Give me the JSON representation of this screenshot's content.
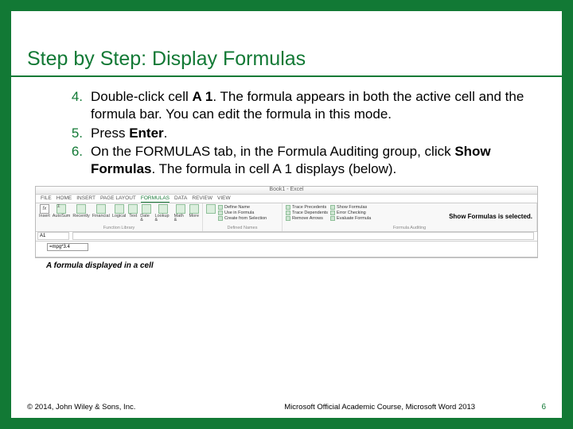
{
  "title": "Step by Step: Display Formulas",
  "steps": [
    {
      "num": "4.",
      "parts": [
        "Double-click cell ",
        "A 1",
        ". The formula appears in both the active cell and the formula bar. You can edit the formula in this mode."
      ]
    },
    {
      "num": "5.",
      "parts": [
        "Press ",
        "Enter",
        "."
      ]
    },
    {
      "num": "6.",
      "parts": [
        "On the FORMULAS tab, in the Formula Auditing group, click ",
        "Show Formulas",
        ". The formula in cell A 1 displays (below)."
      ]
    }
  ],
  "figure": {
    "window_title": "Book1 - Excel",
    "tabs": [
      "FILE",
      "HOME",
      "INSERT",
      "PAGE LAYOUT",
      "FORMULAS",
      "DATA",
      "REVIEW",
      "VIEW"
    ],
    "active_tab": "FORMULAS",
    "groups": {
      "fnlib": {
        "label": "Function Library",
        "items": [
          "Insert Function",
          "AutoSum",
          "Recently Used",
          "Financial",
          "Logical",
          "Text",
          "Date & Time",
          "Lookup & Reference",
          "Math & Trig",
          "More Functions"
        ],
        "short": [
          "fx",
          "Σ",
          "★",
          "$",
          "?",
          "A",
          "⌚",
          "🔍",
          "θ",
          "…"
        ],
        "lbl": [
          "Insert",
          "AutoSum",
          "Recently",
          "Financial",
          "Logical",
          "Text",
          "Date &",
          "Lookup &",
          "Math &",
          "More"
        ]
      },
      "names": {
        "label": "Defined Names",
        "items": [
          "Name Manager",
          "Define Name",
          "Use in Formula",
          "Create from Selection"
        ]
      },
      "audit": {
        "label": "Formula Auditing",
        "left": [
          "Trace Precedents",
          "Trace Dependents",
          "Remove Arrows"
        ],
        "right": [
          "Show Formulas",
          "Error Checking",
          "Evaluate Formula"
        ]
      }
    },
    "namebox": "A1",
    "cell_a1": "=mpg*3.4",
    "callout": "Show Formulas is selected.",
    "caption": "A formula displayed in a cell"
  },
  "footer": {
    "left": "© 2014, John Wiley & Sons, Inc.",
    "center": "Microsoft Official Academic Course, Microsoft Word 2013",
    "page": "6"
  }
}
